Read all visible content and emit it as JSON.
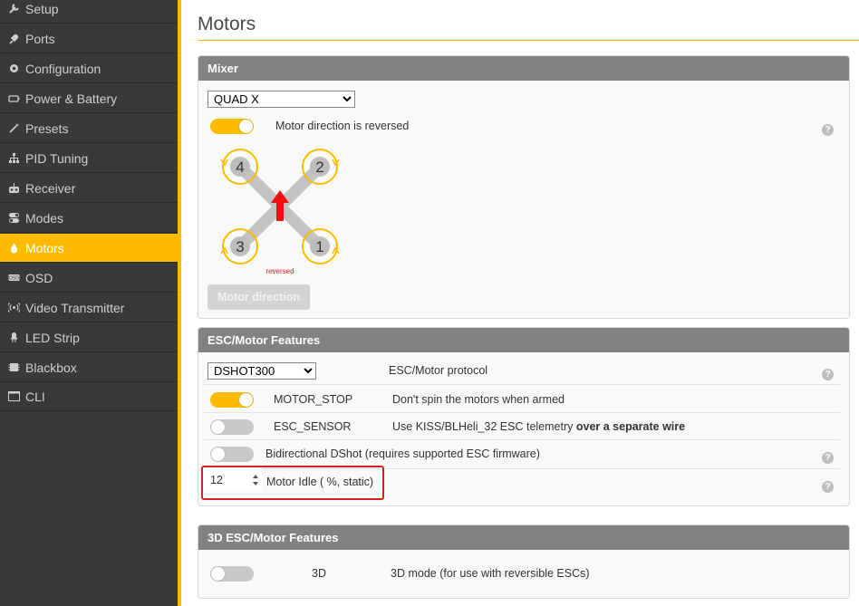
{
  "sidebar": {
    "items": [
      {
        "label": "Setup",
        "icon": "wrench-icon"
      },
      {
        "label": "Ports",
        "icon": "plug-icon"
      },
      {
        "label": "Configuration",
        "icon": "gear-icon"
      },
      {
        "label": "Power & Battery",
        "icon": "battery-icon"
      },
      {
        "label": "Presets",
        "icon": "magic-icon"
      },
      {
        "label": "PID Tuning",
        "icon": "sitemap-icon"
      },
      {
        "label": "Receiver",
        "icon": "remote-icon"
      },
      {
        "label": "Modes",
        "icon": "toggle-icon"
      },
      {
        "label": "Motors",
        "icon": "motor-icon",
        "active": true
      },
      {
        "label": "OSD",
        "icon": "osd-icon"
      },
      {
        "label": "Video Transmitter",
        "icon": "antenna-icon"
      },
      {
        "label": "LED Strip",
        "icon": "led-icon"
      },
      {
        "label": "Blackbox",
        "icon": "blackbox-icon"
      },
      {
        "label": "CLI",
        "icon": "terminal-icon"
      }
    ]
  },
  "page": {
    "title": "Motors"
  },
  "mixer": {
    "heading": "Mixer",
    "mixer_type": "QUAD X",
    "reverse_toggle_label": "Motor direction is reversed",
    "reverse_on": true,
    "diagram": {
      "motors": [
        "4",
        "2",
        "3",
        "1"
      ],
      "caption": "reversed"
    },
    "motor_direction_button": "Motor direction"
  },
  "esc": {
    "heading": "ESC/Motor Features",
    "protocol_value": "DSHOT300",
    "protocol_label": "ESC/Motor protocol",
    "motor_stop": {
      "name": "MOTOR_STOP",
      "desc": "Don't spin the motors when armed",
      "on": true
    },
    "esc_sensor": {
      "name": "ESC_SENSOR",
      "desc_prefix": "Use KISS/BLHeli_32 ESC telemetry ",
      "desc_bold": "over a separate wire",
      "on": false
    },
    "bidir": {
      "label": "Bidirectional DShot (requires supported ESC firmware)",
      "on": false
    },
    "idle": {
      "value": "12",
      "label": "Motor Idle ( %, static)"
    }
  },
  "esc3d": {
    "heading": "3D ESC/Motor Features",
    "mode": {
      "name": "3D",
      "desc": "3D mode (for use with reversible ESCs)",
      "on": false
    }
  },
  "colors": {
    "accent": "#ffbb00",
    "sidebar": "#393939",
    "panel_head": "#828282",
    "highlight": "#d9201b"
  }
}
